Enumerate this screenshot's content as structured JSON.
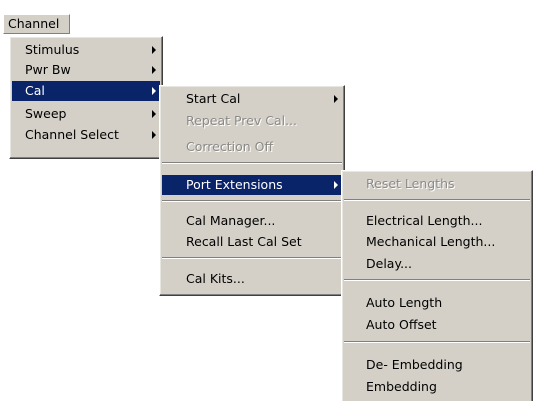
{
  "menubar": {
    "channel_label": "Channel"
  },
  "channel_menu": {
    "items": [
      {
        "label": "Stimulus"
      },
      {
        "label": "Pwr Bw"
      },
      {
        "label": "Cal"
      },
      {
        "label": "Sweep"
      },
      {
        "label": "Channel Select"
      }
    ]
  },
  "cal_menu": {
    "items": [
      {
        "label": "Start Cal"
      },
      {
        "label": "Repeat Prev Cal..."
      },
      {
        "label": "Correction Off"
      },
      {
        "label": "Port Extensions"
      },
      {
        "label": "Cal Manager..."
      },
      {
        "label": "Recall Last Cal Set"
      },
      {
        "label": "Cal Kits..."
      }
    ]
  },
  "port_ext_menu": {
    "items": [
      {
        "label": "Reset Lengths"
      },
      {
        "label": "Electrical Length..."
      },
      {
        "label": "Mechanical Length..."
      },
      {
        "label": "Delay..."
      },
      {
        "label": "Auto Length"
      },
      {
        "label": "Auto Offset"
      },
      {
        "label": "De- Embedding"
      },
      {
        "label": "Embedding"
      }
    ]
  }
}
